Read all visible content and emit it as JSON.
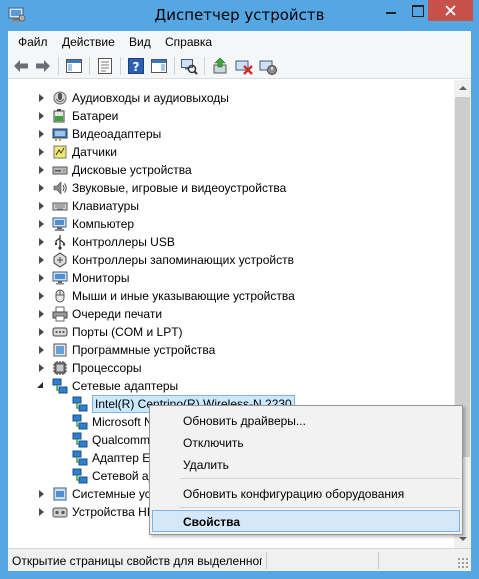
{
  "window": {
    "title": "Диспетчер устройств"
  },
  "menu": [
    "Файл",
    "Действие",
    "Вид",
    "Справка"
  ],
  "tree": [
    {
      "label": "Аудиовходы и аудиовыходы",
      "level": 1,
      "state": "collapsed",
      "icon": "audio-io-icon"
    },
    {
      "label": "Батареи",
      "level": 1,
      "state": "collapsed",
      "icon": "battery-icon"
    },
    {
      "label": "Видеоадаптеры",
      "level": 1,
      "state": "collapsed",
      "icon": "display-adapter-icon"
    },
    {
      "label": "Датчики",
      "level": 1,
      "state": "collapsed",
      "icon": "sensor-icon"
    },
    {
      "label": "Дисковые устройства",
      "level": 1,
      "state": "collapsed",
      "icon": "disk-drive-icon"
    },
    {
      "label": "Звуковые, игровые и видеоустройства",
      "level": 1,
      "state": "collapsed",
      "icon": "speaker-icon"
    },
    {
      "label": "Клавиатуры",
      "level": 1,
      "state": "collapsed",
      "icon": "keyboard-icon"
    },
    {
      "label": "Компьютер",
      "level": 1,
      "state": "collapsed",
      "icon": "computer-icon"
    },
    {
      "label": "Контроллеры USB",
      "level": 1,
      "state": "collapsed",
      "icon": "usb-controller-icon"
    },
    {
      "label": "Контроллеры запоминающих устройств",
      "level": 1,
      "state": "collapsed",
      "icon": "storage-controller-icon"
    },
    {
      "label": "Мониторы",
      "level": 1,
      "state": "collapsed",
      "icon": "monitor-icon"
    },
    {
      "label": "Мыши и иные указывающие устройства",
      "level": 1,
      "state": "collapsed",
      "icon": "mouse-icon"
    },
    {
      "label": "Очереди печати",
      "level": 1,
      "state": "collapsed",
      "icon": "printer-icon"
    },
    {
      "label": "Порты (COM и LPT)",
      "level": 1,
      "state": "collapsed",
      "icon": "port-icon"
    },
    {
      "label": "Программные устройства",
      "level": 1,
      "state": "collapsed",
      "icon": "software-device-icon"
    },
    {
      "label": "Процессоры",
      "level": 1,
      "state": "collapsed",
      "icon": "processor-icon"
    },
    {
      "label": "Сетевые адаптеры",
      "level": 1,
      "state": "expanded",
      "icon": "network-adapter-icon"
    },
    {
      "label": "Intel(R) Centrino(R) Wireless-N 2230",
      "level": 2,
      "state": "leaf",
      "selected": true,
      "icon": "network-adapter-icon"
    },
    {
      "label": "Microsoft N",
      "level": 2,
      "state": "leaf",
      "icon": "network-adapter-icon"
    },
    {
      "label": "Qualcomm",
      "level": 2,
      "state": "leaf",
      "icon": "network-adapter-icon"
    },
    {
      "label": "Адаптер Et",
      "level": 2,
      "state": "leaf",
      "icon": "network-adapter-icon"
    },
    {
      "label": "Сетевой ад",
      "level": 2,
      "state": "leaf",
      "icon": "network-adapter-icon"
    },
    {
      "label": "Системные уст",
      "level": 1,
      "state": "collapsed",
      "icon": "system-device-icon"
    },
    {
      "label": "Устройства HI",
      "level": 1,
      "state": "collapsed",
      "icon": "hid-device-icon"
    }
  ],
  "context_menu": {
    "items": [
      {
        "label": "Обновить драйверы..."
      },
      {
        "label": "Отключить"
      },
      {
        "label": "Удалить"
      },
      {
        "label": "Обновить конфигурацию оборудования"
      },
      {
        "label": "Свойства",
        "default": true
      }
    ]
  },
  "status": {
    "text": "Открытие страницы свойств для выделенного объекта."
  }
}
